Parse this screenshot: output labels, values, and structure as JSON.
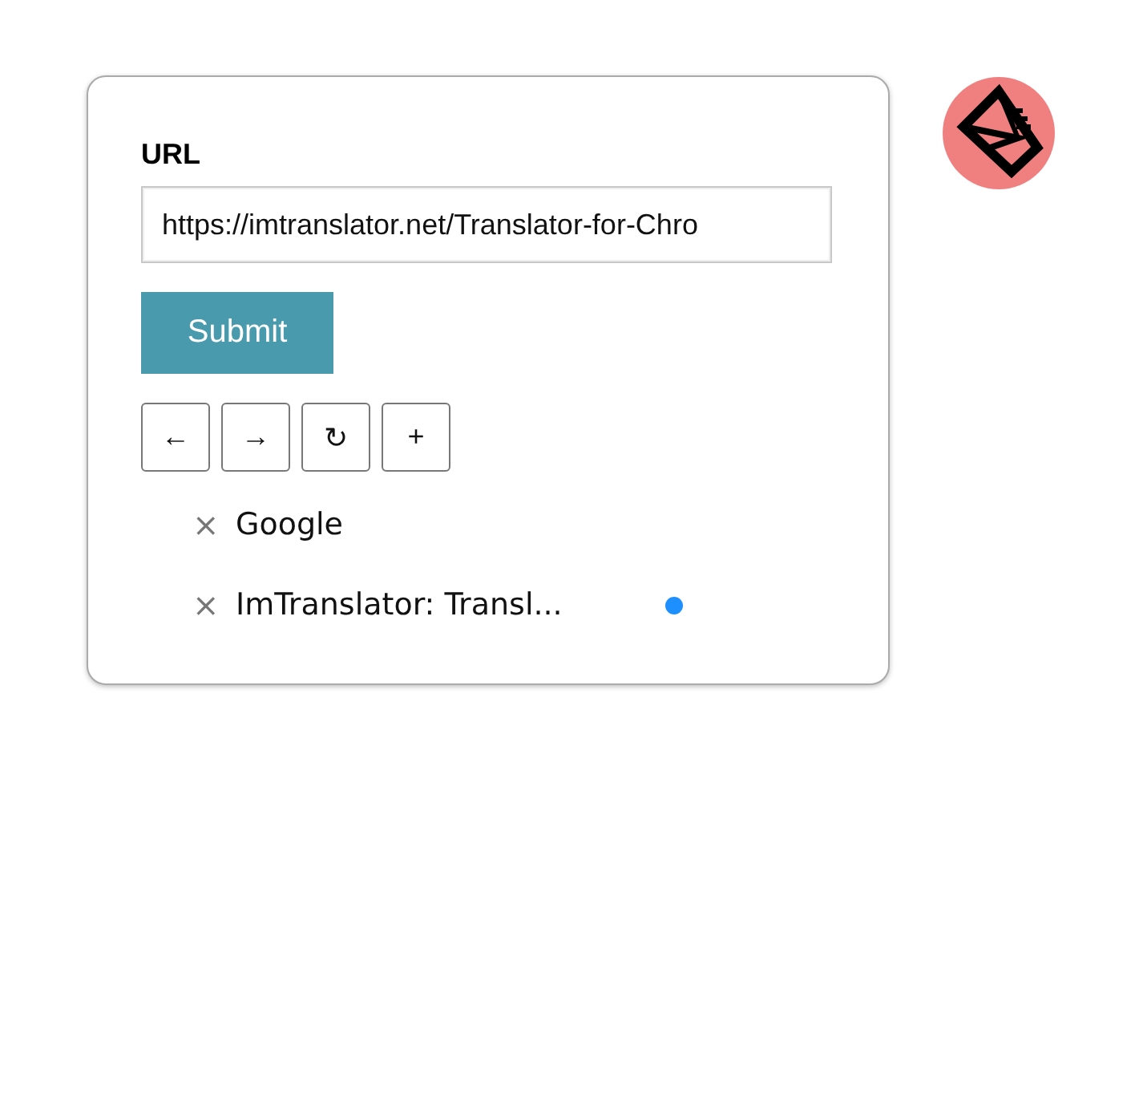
{
  "form": {
    "label": "URL",
    "url": "https://imtranslator.net/Translator-for-Chro",
    "submit": "Submit"
  },
  "nav_buttons": [
    "←",
    "→",
    "↻",
    "+"
  ],
  "tabs": [
    {
      "close": "×",
      "title": "Google",
      "selected": false
    },
    {
      "close": "×",
      "title": "ImTranslator: Transl...",
      "selected": true
    }
  ]
}
